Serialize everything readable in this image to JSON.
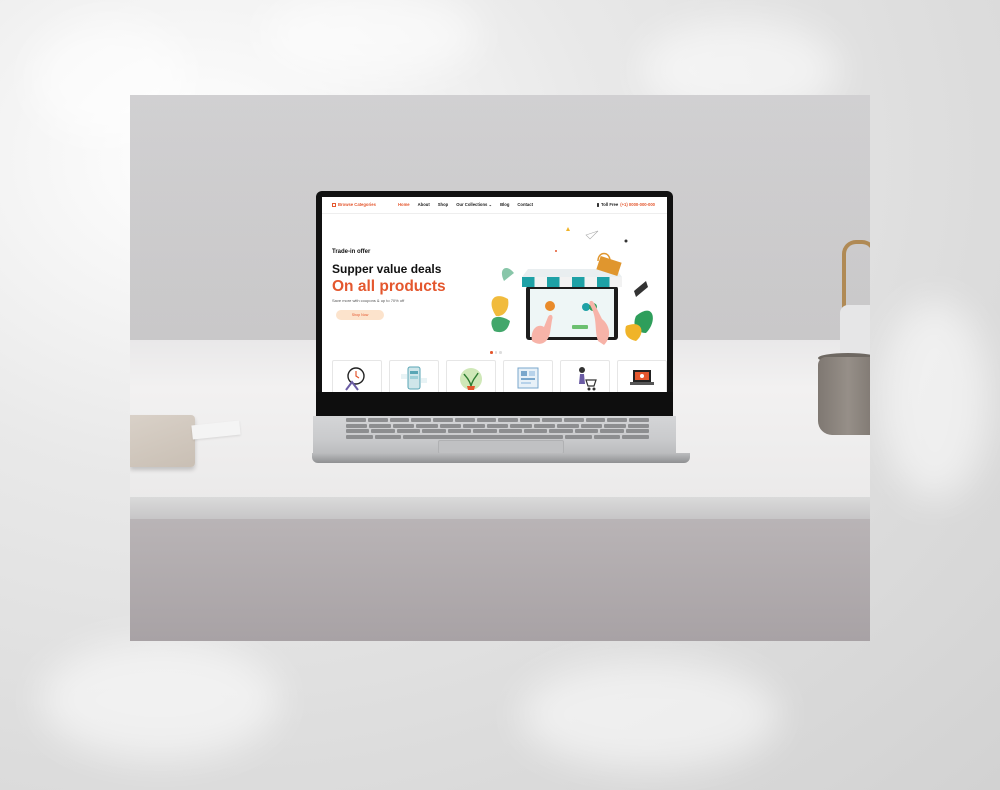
{
  "website": {
    "nav": {
      "browse_categories": "Browse Categories",
      "links": [
        "Home",
        "About",
        "Shop",
        "Our Collections",
        "Blog",
        "Contact"
      ],
      "active_link": "Home",
      "toll_free_label": "Toll Free",
      "toll_free_number": "(+1) 0000-000-000"
    },
    "hero": {
      "subtitle": "Trade-in offer",
      "title_line1": "Supper value deals",
      "title_line2": "On all products",
      "description": "Save more with coupons & up to 70% off",
      "cta_label": "Shop Now"
    },
    "carousel": {
      "slides": 3,
      "active_slide": 1
    },
    "category_cards": [
      {
        "icon": "delivery-clock-icon"
      },
      {
        "icon": "mobile-dashboard-icon"
      },
      {
        "icon": "plant-pot-icon"
      },
      {
        "icon": "app-screens-icon"
      },
      {
        "icon": "shopping-cart-person-icon"
      },
      {
        "icon": "laptop-shop-icon"
      }
    ],
    "colors": {
      "accent": "#e4572e",
      "cta_bg": "#fce3cc",
      "awning_teal": "#1ea1a6"
    }
  }
}
